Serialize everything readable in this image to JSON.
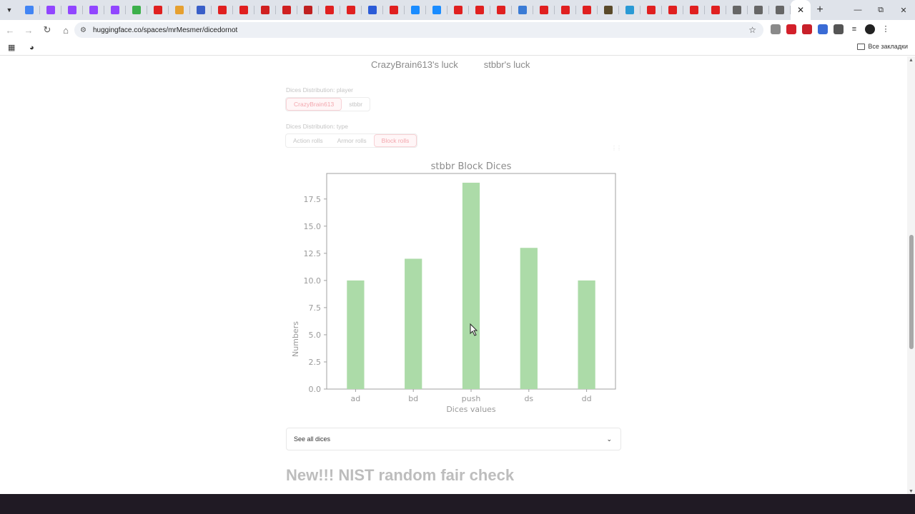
{
  "browser": {
    "tabs": [
      {
        "icon": "google-g",
        "color": "#4285f4"
      },
      {
        "icon": "twitch",
        "color": "#9146ff"
      },
      {
        "icon": "twitch",
        "color": "#9146ff"
      },
      {
        "icon": "twitch",
        "color": "#9146ff"
      },
      {
        "icon": "twitch",
        "color": "#9146ff"
      },
      {
        "icon": "puzzle",
        "color": "#3cb04b"
      },
      {
        "icon": "youtube",
        "color": "#e02020"
      },
      {
        "icon": "d",
        "color": "#e6a030"
      },
      {
        "icon": "bot",
        "color": "#3a5fc8"
      },
      {
        "icon": "youtube",
        "color": "#e02020"
      },
      {
        "icon": "seven",
        "color": "#e02020"
      },
      {
        "icon": "curl",
        "color": "#d02020"
      },
      {
        "icon": "curl",
        "color": "#d02020"
      },
      {
        "icon": "swirl",
        "color": "#c02020"
      },
      {
        "icon": "youtube",
        "color": "#e02020"
      },
      {
        "icon": "youtube",
        "color": "#e02020"
      },
      {
        "icon": "eyes",
        "color": "#2b5bd7"
      },
      {
        "icon": "youtube",
        "color": "#e02020"
      },
      {
        "icon": "chat",
        "color": "#1a8cff"
      },
      {
        "icon": "chat",
        "color": "#1a8cff"
      },
      {
        "icon": "youtube",
        "color": "#e02020"
      },
      {
        "icon": "youtube",
        "color": "#e02020"
      },
      {
        "icon": "youtube",
        "color": "#e02020"
      },
      {
        "icon": "image",
        "color": "#3a7bd5"
      },
      {
        "icon": "youtube",
        "color": "#e02020"
      },
      {
        "icon": "youtube",
        "color": "#e02020"
      },
      {
        "icon": "youtube",
        "color": "#e02020"
      },
      {
        "icon": "eye",
        "color": "#5a4a2a"
      },
      {
        "icon": "shield",
        "color": "#2a9ad5"
      },
      {
        "icon": "seven",
        "color": "#e02020"
      },
      {
        "icon": "seven",
        "color": "#e02020"
      },
      {
        "icon": "youtube",
        "color": "#e02020"
      },
      {
        "icon": "youtube",
        "color": "#e02020"
      },
      {
        "icon": "translate",
        "color": "#666666"
      },
      {
        "icon": "translate",
        "color": "#666666"
      },
      {
        "icon": "translate",
        "color": "#666666"
      }
    ],
    "url": "huggingface.co/spaces/mrMesmer/dicedornot",
    "bookmarks_folder": "Все закладки",
    "extensions": [
      {
        "icon": "ext-gray",
        "color": "#8a8a8a"
      },
      {
        "icon": "adblock",
        "color": "#d3202a"
      },
      {
        "icon": "ext-red",
        "color": "#c8202a"
      },
      {
        "icon": "ext-blue",
        "color": "#3a6bd5"
      },
      {
        "icon": "puzzle",
        "color": "#555555"
      }
    ]
  },
  "page": {
    "luck_labels": [
      "CrazyBrain613's luck",
      "stbbr's luck"
    ],
    "player_block": {
      "label": "Dices Distribution: player",
      "options": [
        "CrazyBrain613",
        "stbbr"
      ],
      "selected": "CrazyBrain613"
    },
    "type_block": {
      "label": "Dices Distribution: type",
      "options": [
        "Action rolls",
        "Armor rolls",
        "Block rolls"
      ],
      "selected": "Block rolls"
    },
    "accordion_label": "See all dices",
    "section_heading": "New!!! NIST random fair check"
  },
  "chart_data": {
    "type": "bar",
    "title": "stbbr Block Dices",
    "xlabel": "Dices values",
    "ylabel": "Numbers",
    "categories": [
      "ad",
      "bd",
      "push",
      "ds",
      "dd"
    ],
    "values": [
      10,
      12,
      19,
      13,
      10
    ],
    "ylim": [
      0,
      19.85
    ],
    "yticks": [
      0.0,
      2.5,
      5.0,
      7.5,
      10.0,
      12.5,
      15.0,
      17.5
    ],
    "bar_color": "#acdba8",
    "grid": false
  }
}
